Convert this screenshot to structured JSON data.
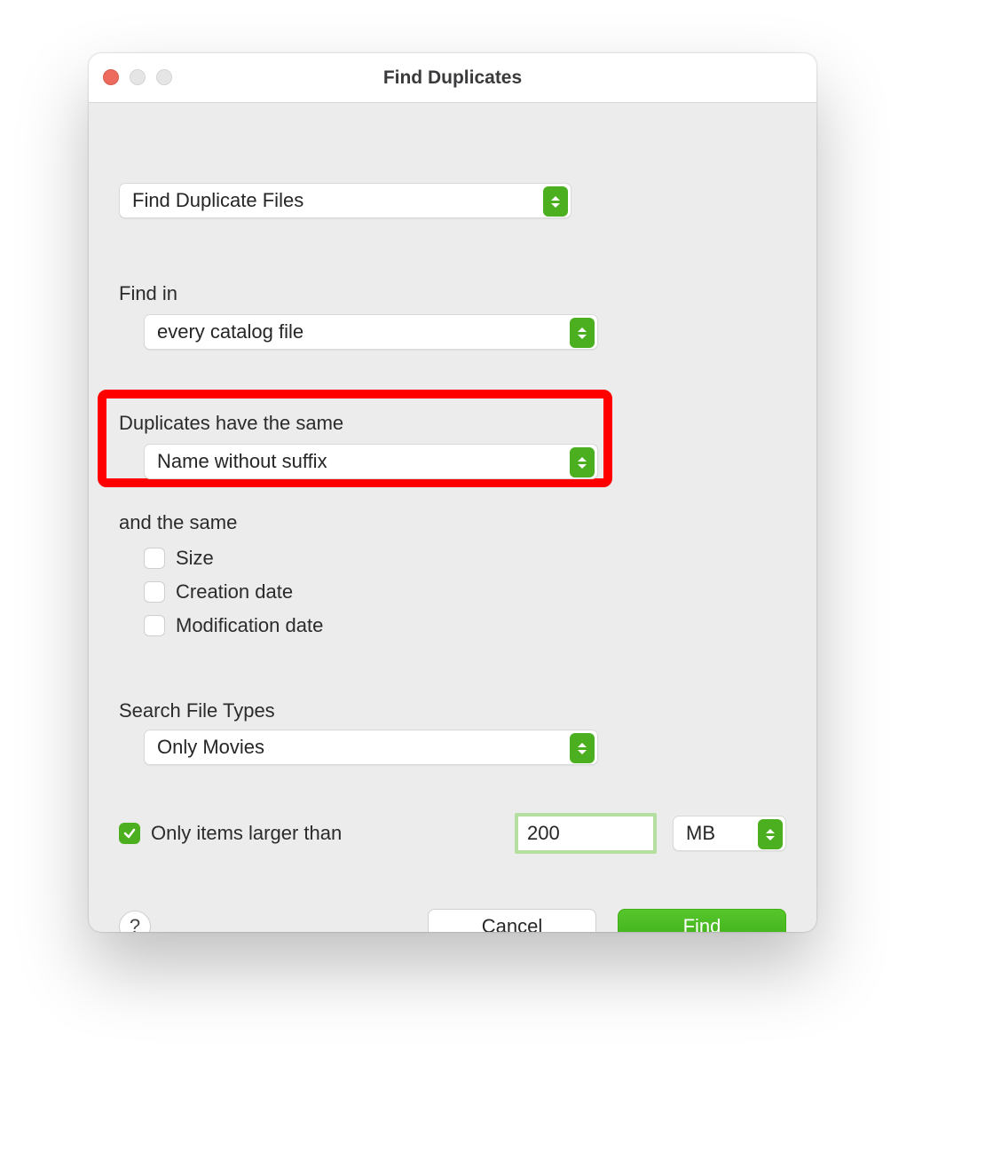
{
  "window": {
    "title": "Find Duplicates"
  },
  "mode": {
    "value": "Find Duplicate Files"
  },
  "find_in": {
    "label": "Find in",
    "value": "every catalog file"
  },
  "duplicates_same": {
    "label": "Duplicates have the same",
    "value": "Name without suffix"
  },
  "and_same": {
    "label": "and the same",
    "size": {
      "label": "Size",
      "checked": false
    },
    "creation": {
      "label": "Creation date",
      "checked": false
    },
    "modification": {
      "label": "Modification date",
      "checked": false
    }
  },
  "file_types": {
    "label": "Search File Types",
    "value": "Only Movies"
  },
  "size_filter": {
    "checked": true,
    "label": "Only items larger than",
    "value": "200",
    "unit": "MB"
  },
  "buttons": {
    "help": "?",
    "cancel": "Cancel",
    "find": "Find"
  }
}
